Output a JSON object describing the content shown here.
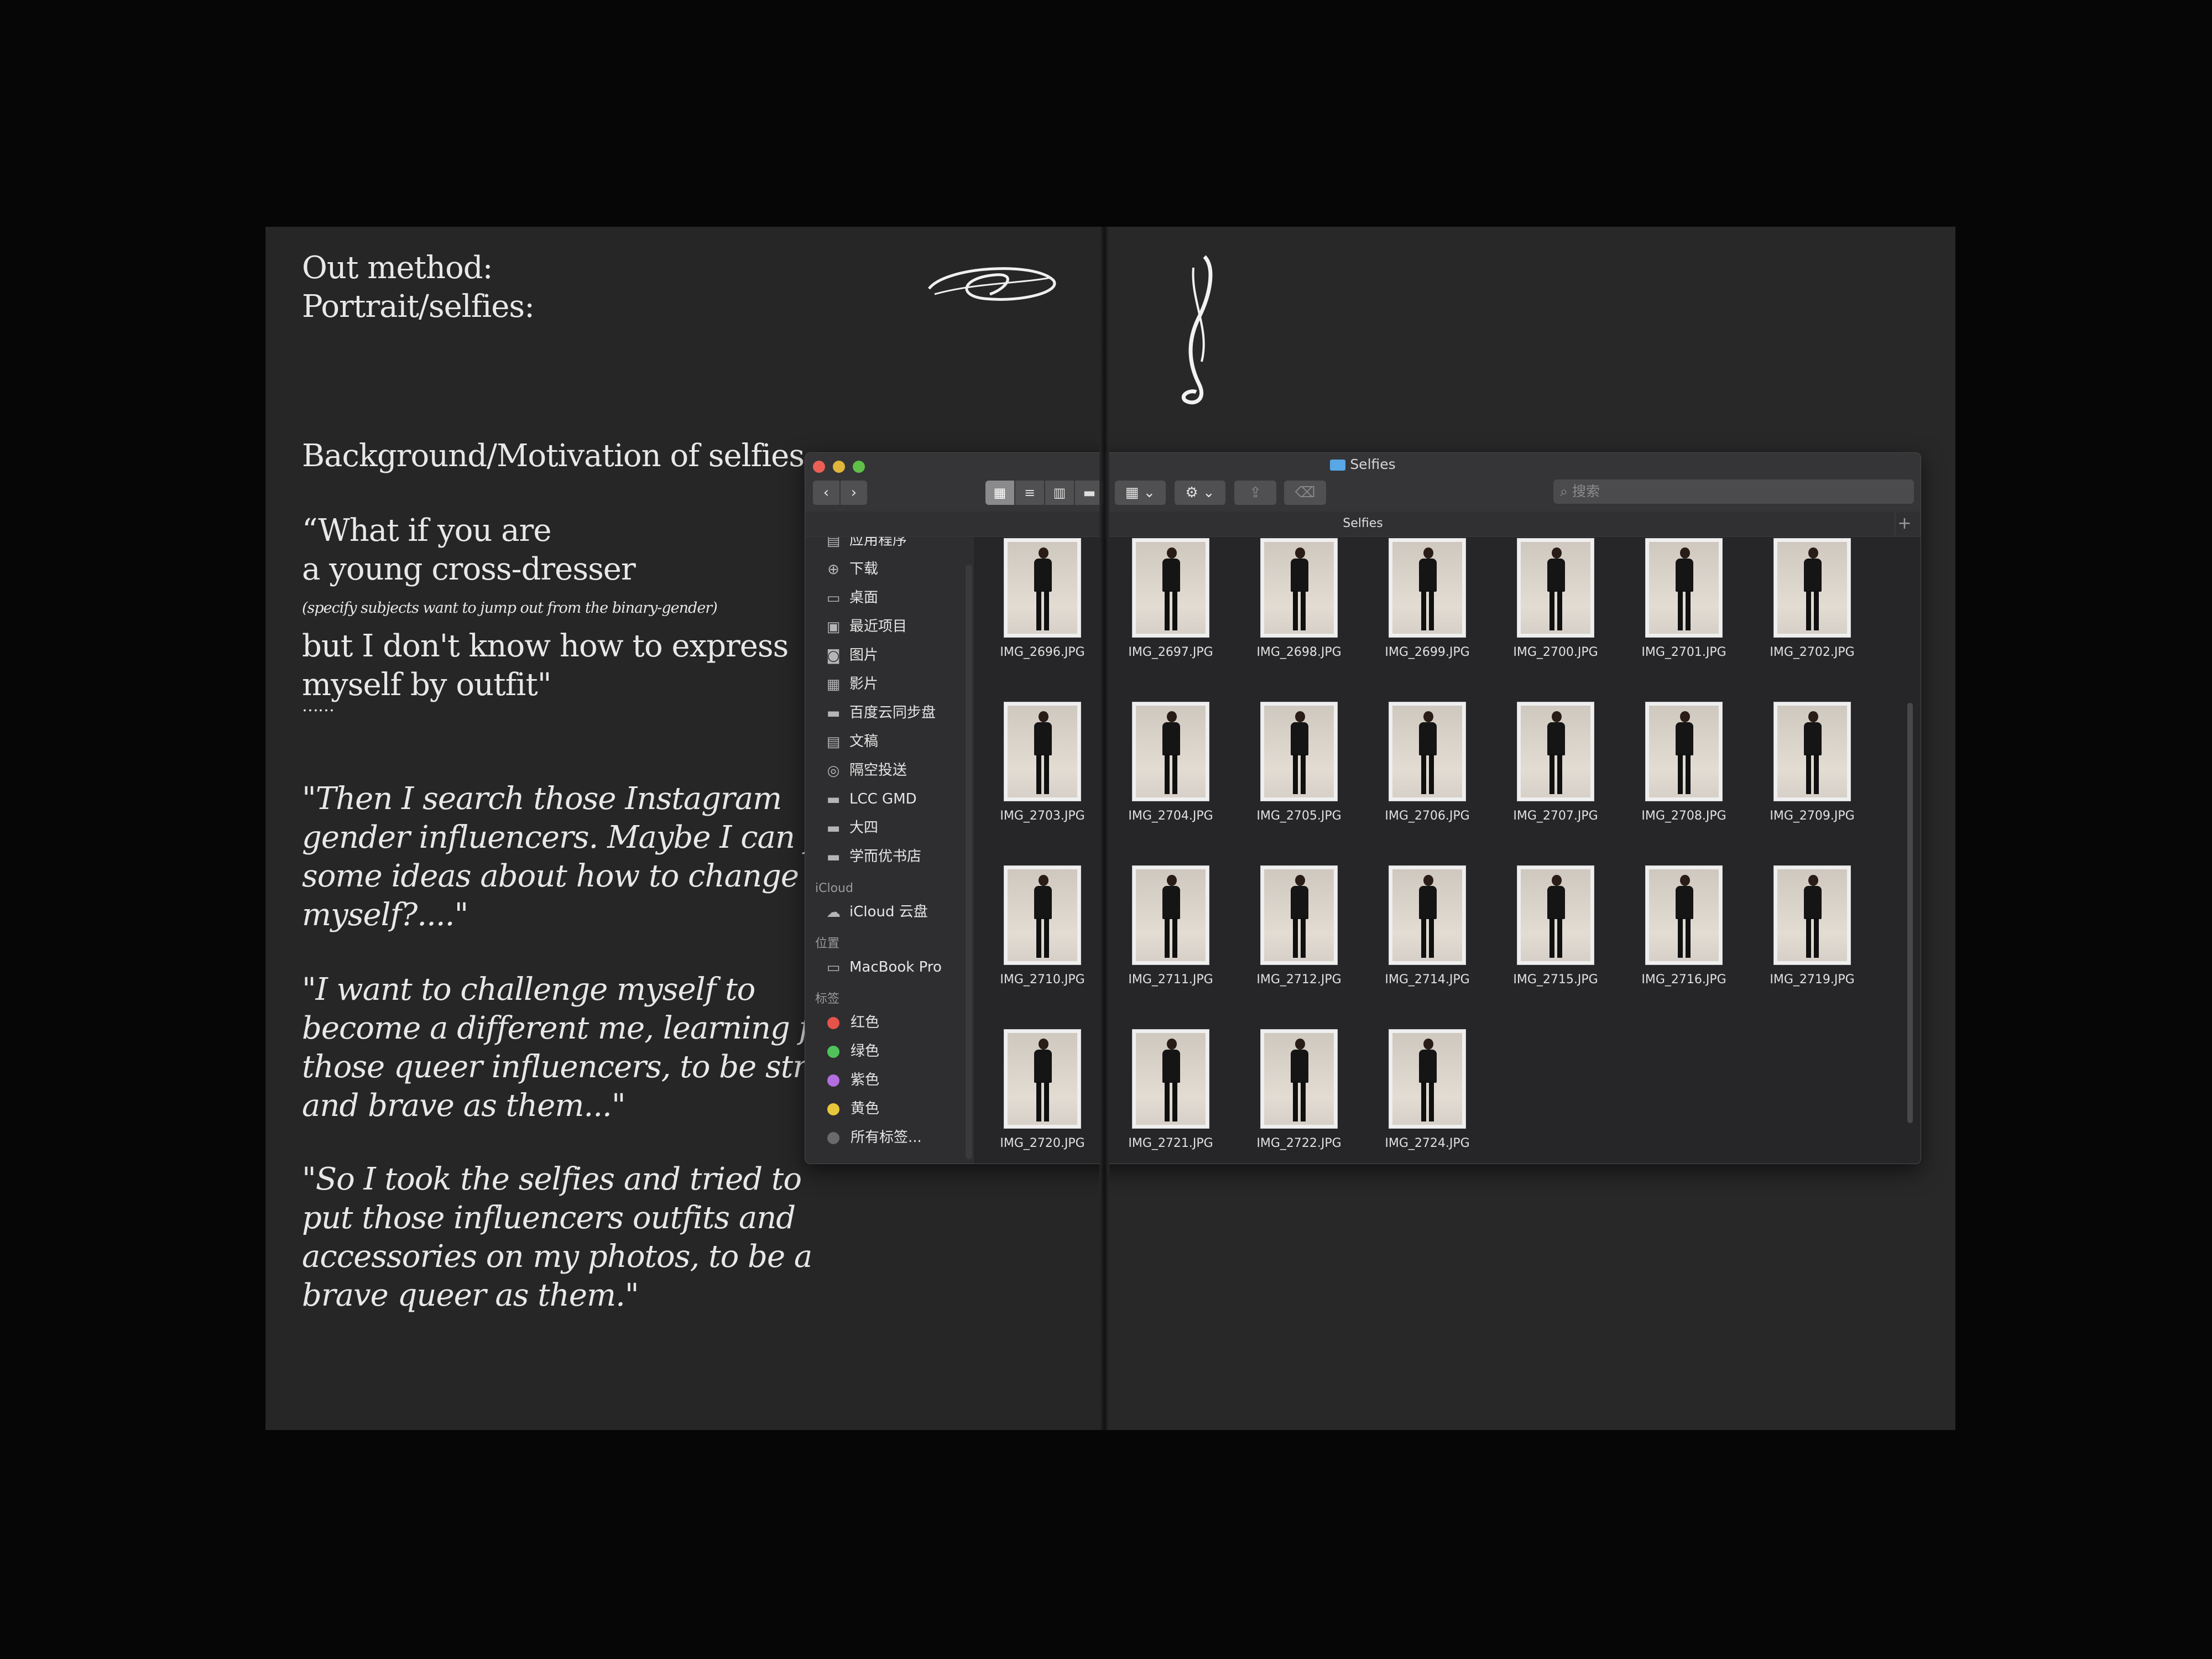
{
  "left_page": {
    "heading_line1": "Out method:",
    "heading_line2": "Portrait/selfies:",
    "bg_title": "Background/Motivation of selfies:",
    "quote1_line1": "“What if you are",
    "quote1_line2": "a young cross-dresser",
    "quote1_note": "(specify subjects want to jump out from the binary-gender)",
    "quote1_line3": "but I don't know how to express",
    "quote1_line4": "myself by outfit\"",
    "ellipsis": "……",
    "quote2": [
      "\"Then I search those Instagram",
      "gender influencers. Maybe I can find",
      "some ideas about how to change",
      "myself?....\""
    ],
    "quote3": [
      "\"I want to challenge myself to",
      "become a different me, learning from",
      "those queer influencers, to be strong",
      "and brave as them...\""
    ],
    "quote4": [
      "\"So I took the selfies and tried to",
      "put those influencers outfits and",
      "accessories on my photos, to be a",
      "brave queer as them.\""
    ]
  },
  "finder": {
    "window_title": "Selfies",
    "path_title": "Selfies",
    "search_placeholder": "搜索",
    "back_icon": "‹",
    "forward_icon": "›",
    "sidebar": {
      "favorites": [
        {
          "label": "应用程序",
          "icon": "apps-icon"
        },
        {
          "label": "下载",
          "icon": "download-icon"
        },
        {
          "label": "桌面",
          "icon": "desktop-icon"
        },
        {
          "label": "最近项目",
          "icon": "recents-icon"
        },
        {
          "label": "图片",
          "icon": "camera-icon"
        },
        {
          "label": "影片",
          "icon": "film-icon"
        },
        {
          "label": "百度云同步盘",
          "icon": "folder-icon"
        },
        {
          "label": "文稿",
          "icon": "document-icon"
        },
        {
          "label": "隔空投送",
          "icon": "airdrop-icon"
        },
        {
          "label": "LCC GMD",
          "icon": "folder-icon"
        },
        {
          "label": "大四",
          "icon": "folder-icon"
        },
        {
          "label": "学而优书店",
          "icon": "folder-icon"
        }
      ],
      "icloud_header": "iCloud",
      "icloud": [
        {
          "label": "iCloud 云盘",
          "icon": "cloud-icon"
        }
      ],
      "locations_header": "位置",
      "locations": [
        {
          "label": "MacBook Pro",
          "icon": "laptop-icon"
        }
      ],
      "tags_header": "标签",
      "tags": [
        {
          "label": "红色",
          "color": "#e5534b"
        },
        {
          "label": "绿色",
          "color": "#4fc25a"
        },
        {
          "label": "紫色",
          "color": "#b36ee0"
        },
        {
          "label": "黄色",
          "color": "#e8c73a"
        },
        {
          "label": "所有标签...",
          "color": "#6a6a6c"
        }
      ]
    },
    "files": [
      "IMG_2696.JPG",
      "IMG_2697.JPG",
      "IMG_2698.JPG",
      "IMG_2699.JPG",
      "IMG_2700.JPG",
      "IMG_2701.JPG",
      "IMG_2702.JPG",
      "IMG_2703.JPG",
      "IMG_2704.JPG",
      "IMG_2705.JPG",
      "IMG_2706.JPG",
      "IMG_2707.JPG",
      "IMG_2708.JPG",
      "IMG_2709.JPG",
      "IMG_2710.JPG",
      "IMG_2711.JPG",
      "IMG_2712.JPG",
      "IMG_2714.JPG",
      "IMG_2715.JPG",
      "IMG_2716.JPG",
      "IMG_2719.JPG",
      "IMG_2720.JPG",
      "IMG_2721.JPG",
      "IMG_2722.JPG",
      "IMG_2724.JPG"
    ]
  }
}
